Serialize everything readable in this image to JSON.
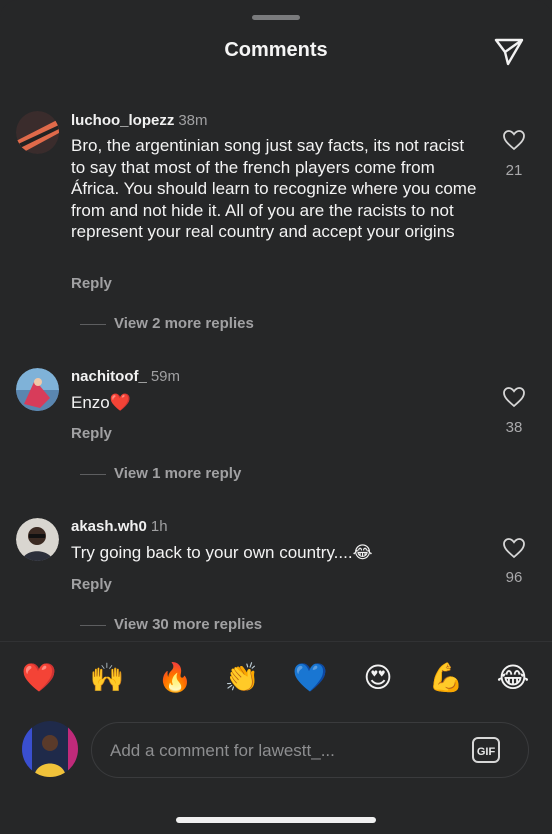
{
  "header": {
    "title": "Comments"
  },
  "comments": [
    {
      "username": "luchoo_lopezz",
      "time": "38m",
      "text": "Bro, the argentinian song just say facts, its not racist to say that most of the french players come from África. You should learn to recognize where you come from and not hide it. All of you are the racists to not represent your real country and accept your origins",
      "reply_label": "Reply",
      "likes": "21",
      "more_replies": "View 2 more replies"
    },
    {
      "username": "nachitoof_",
      "time": "59m",
      "text": "Enzo❤️",
      "reply_label": "Reply",
      "likes": "38",
      "more_replies": "View 1 more reply"
    },
    {
      "username": "akash.wh0",
      "time": "1h",
      "text": "Try going back to your own country....😂",
      "reply_label": "Reply",
      "likes": "96",
      "more_replies": "View 30 more replies"
    }
  ],
  "quick_reactions": [
    "❤️",
    "🙌",
    "🔥",
    "👏",
    "💙",
    "😍",
    "💪",
    "😂"
  ],
  "composer": {
    "placeholder": "Add a comment for lawestt_...",
    "gif_label": "GIF"
  },
  "colors": {
    "background": "#262728",
    "secondary_text": "#a1a1a3"
  }
}
